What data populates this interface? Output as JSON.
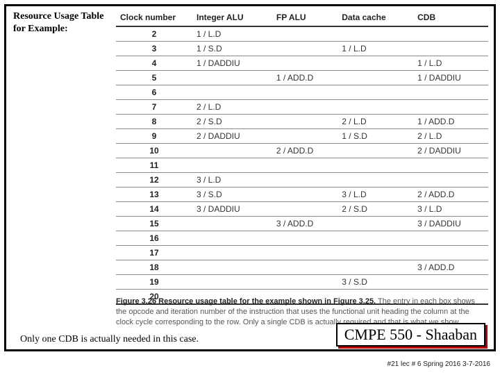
{
  "header": {
    "label": "Resource Usage Table for Example:"
  },
  "table": {
    "headers": [
      "Clock number",
      "Integer ALU",
      "FP ALU",
      "Data cache",
      "CDB"
    ],
    "rows": [
      {
        "clock": "2",
        "ialu": "1 / L.D",
        "fpalu": "",
        "dcache": "",
        "cdb": ""
      },
      {
        "clock": "3",
        "ialu": "1 / S.D",
        "fpalu": "",
        "dcache": "1 / L.D",
        "cdb": ""
      },
      {
        "clock": "4",
        "ialu": "1 / DADDIU",
        "fpalu": "",
        "dcache": "",
        "cdb": "1 / L.D"
      },
      {
        "clock": "5",
        "ialu": "",
        "fpalu": "1 / ADD.D",
        "dcache": "",
        "cdb": "1 / DADDIU"
      },
      {
        "clock": "6",
        "ialu": "",
        "fpalu": "",
        "dcache": "",
        "cdb": ""
      },
      {
        "clock": "7",
        "ialu": "2 / L.D",
        "fpalu": "",
        "dcache": "",
        "cdb": ""
      },
      {
        "clock": "8",
        "ialu": "2 / S.D",
        "fpalu": "",
        "dcache": "2 / L.D",
        "cdb": "1 / ADD.D"
      },
      {
        "clock": "9",
        "ialu": "2 / DADDIU",
        "fpalu": "",
        "dcache": "1 / S.D",
        "cdb": "2 / L.D"
      },
      {
        "clock": "10",
        "ialu": "",
        "fpalu": "2 / ADD.D",
        "dcache": "",
        "cdb": "2 / DADDIU"
      },
      {
        "clock": "11",
        "ialu": "",
        "fpalu": "",
        "dcache": "",
        "cdb": ""
      },
      {
        "clock": "12",
        "ialu": "3 / L.D",
        "fpalu": "",
        "dcache": "",
        "cdb": ""
      },
      {
        "clock": "13",
        "ialu": "3 / S.D",
        "fpalu": "",
        "dcache": "3 / L.D",
        "cdb": "2 / ADD.D"
      },
      {
        "clock": "14",
        "ialu": "3 / DADDIU",
        "fpalu": "",
        "dcache": "2 / S.D",
        "cdb": "3 / L.D"
      },
      {
        "clock": "15",
        "ialu": "",
        "fpalu": "3 / ADD.D",
        "dcache": "",
        "cdb": "3 / DADDIU"
      },
      {
        "clock": "16",
        "ialu": "",
        "fpalu": "",
        "dcache": "",
        "cdb": ""
      },
      {
        "clock": "17",
        "ialu": "",
        "fpalu": "",
        "dcache": "",
        "cdb": ""
      },
      {
        "clock": "18",
        "ialu": "",
        "fpalu": "",
        "dcache": "",
        "cdb": "3 / ADD.D"
      },
      {
        "clock": "19",
        "ialu": "",
        "fpalu": "",
        "dcache": "3 / S.D",
        "cdb": ""
      },
      {
        "clock": "20",
        "ialu": "",
        "fpalu": "",
        "dcache": "",
        "cdb": ""
      }
    ]
  },
  "caption": {
    "lead": "Figure 3.26   Resource usage table for the example shown in Figure 3.25.",
    "rest": " The entry in each box shows the opcode and iteration number of the instruction that uses the functional unit heading the column at the clock cycle corresponding to the row. Only a single CDB is actually required and that is what we show."
  },
  "footer": {
    "note": "Only one CDB is actually needed in this case."
  },
  "course": {
    "tag": "CMPE 550 - Shaaban"
  },
  "meta": {
    "text": "#21  lec # 6  Spring 2016  3-7-2016"
  }
}
